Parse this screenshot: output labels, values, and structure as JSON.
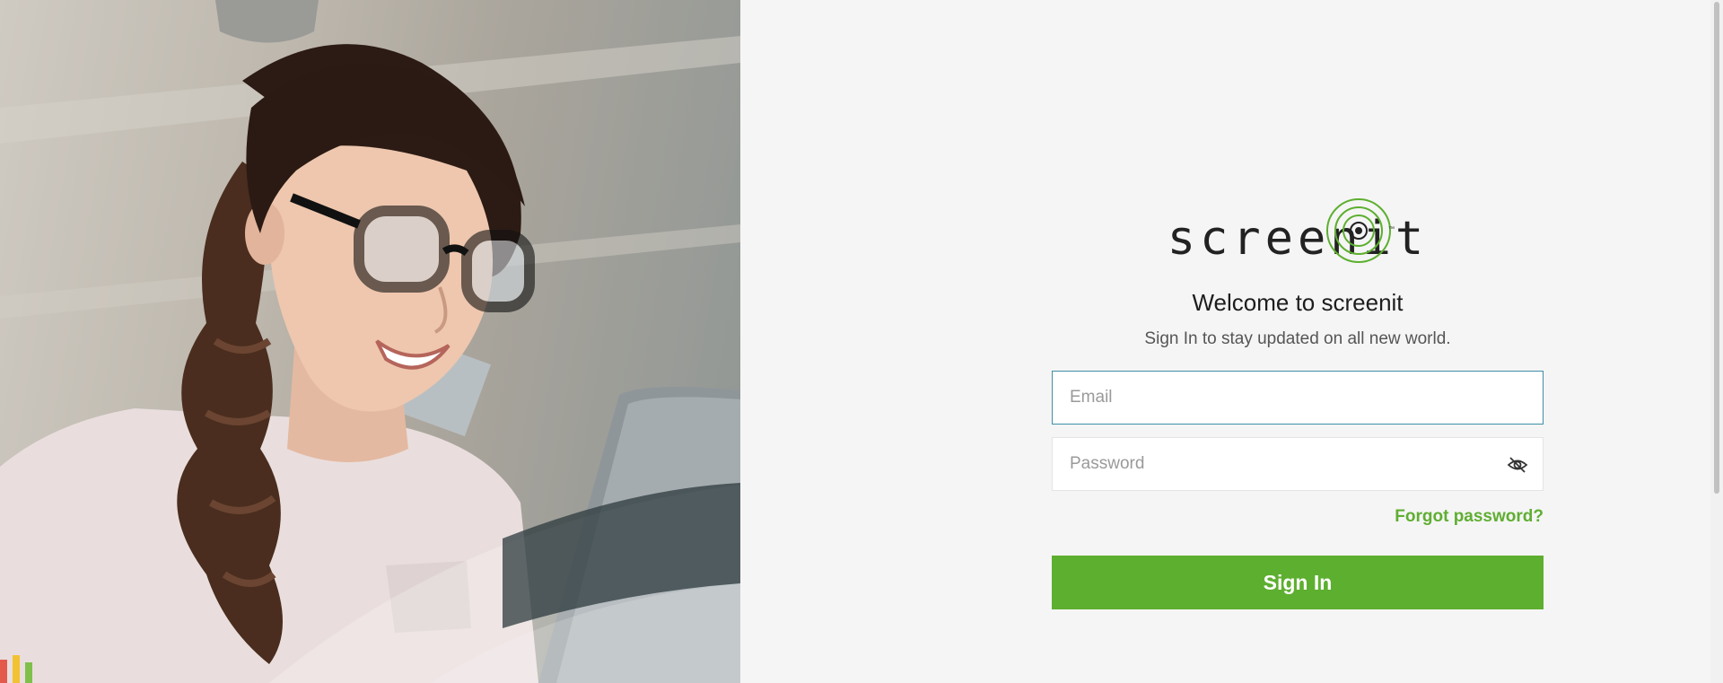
{
  "brand": {
    "logo_text": "screenit",
    "trademark": "™",
    "accent_color": "#5daf2f"
  },
  "form": {
    "title": "Welcome to screenit",
    "subtitle": "Sign In to stay updated on all new world.",
    "email_placeholder": "Email",
    "email_value": "",
    "password_placeholder": "Password",
    "password_value": "",
    "password_toggle_icon": "eye-slash-icon",
    "forgot_label": "Forgot password?",
    "signin_label": "Sign In"
  },
  "hero": {
    "image_subject": "woman-with-glasses-smiling-at-laptop"
  }
}
